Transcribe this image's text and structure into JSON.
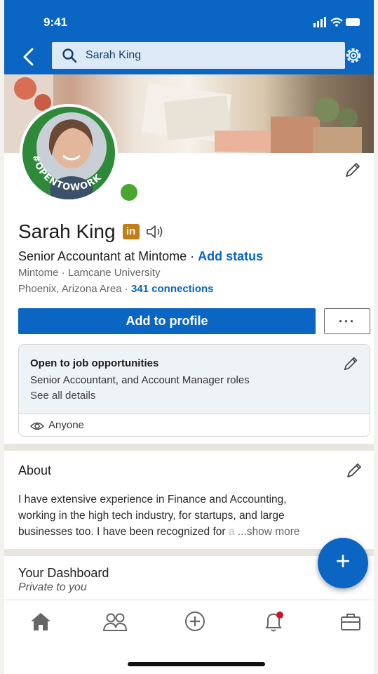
{
  "status": {
    "time": "9:41"
  },
  "search": {
    "query": "Sarah King"
  },
  "profile": {
    "name": "Sarah King",
    "badge": "in",
    "open_to_work_frame": "#OPENTOWORK",
    "headline": "Senior Accountant at Mintome",
    "headline_sep": " · ",
    "add_status": "Add status",
    "education": "Mintome · Lamcane University",
    "location": "Phoenix, Arizona Area",
    "location_sep": " · ",
    "connections": "341 connections",
    "add_to_profile": "Add to profile",
    "more": "···"
  },
  "open_to_work": {
    "title": "Open to job opportunities",
    "roles": "Senior Accountant, and Account Manager roles",
    "see_all": "See all details",
    "visibility": "Anyone"
  },
  "about": {
    "title": "About",
    "line1": "I have extensive experience in Finance and Accounting,",
    "line2": "working in the high tech industry, for startups, and large",
    "line3": "businesses too. I have been recognized for ",
    "line3_fade": "a",
    "show_more": " ...show more"
  },
  "dashboard": {
    "title": "Your Dashboard",
    "subtitle": "Private to you"
  },
  "fab": {
    "label": "+"
  },
  "colors": {
    "brand": "#0a66c2",
    "badge": "#c37d16",
    "open_to_work": "#2e8a3a",
    "notification": "#d11124"
  },
  "tabs": [
    "home-icon",
    "my-network-icon",
    "post-icon",
    "notifications-icon",
    "jobs-icon"
  ]
}
